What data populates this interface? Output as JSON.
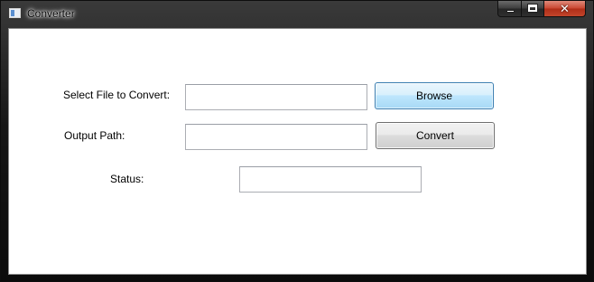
{
  "window": {
    "title": "Converter",
    "app_icon": "window-app-icon",
    "caption_buttons": {
      "minimize_icon": "minimize-icon",
      "maximize_icon": "maximize-icon",
      "close_glyph": "✕"
    }
  },
  "form": {
    "select_file_label": "Select File to Convert:",
    "select_file_value": "",
    "browse_label": "Browse",
    "output_path_label": "Output Path:",
    "output_path_value": "",
    "convert_label": "Convert",
    "status_label": "Status:",
    "status_value": ""
  },
  "colors": {
    "browse_accent": "#3c7fb1",
    "close_button": "#c9452f"
  }
}
